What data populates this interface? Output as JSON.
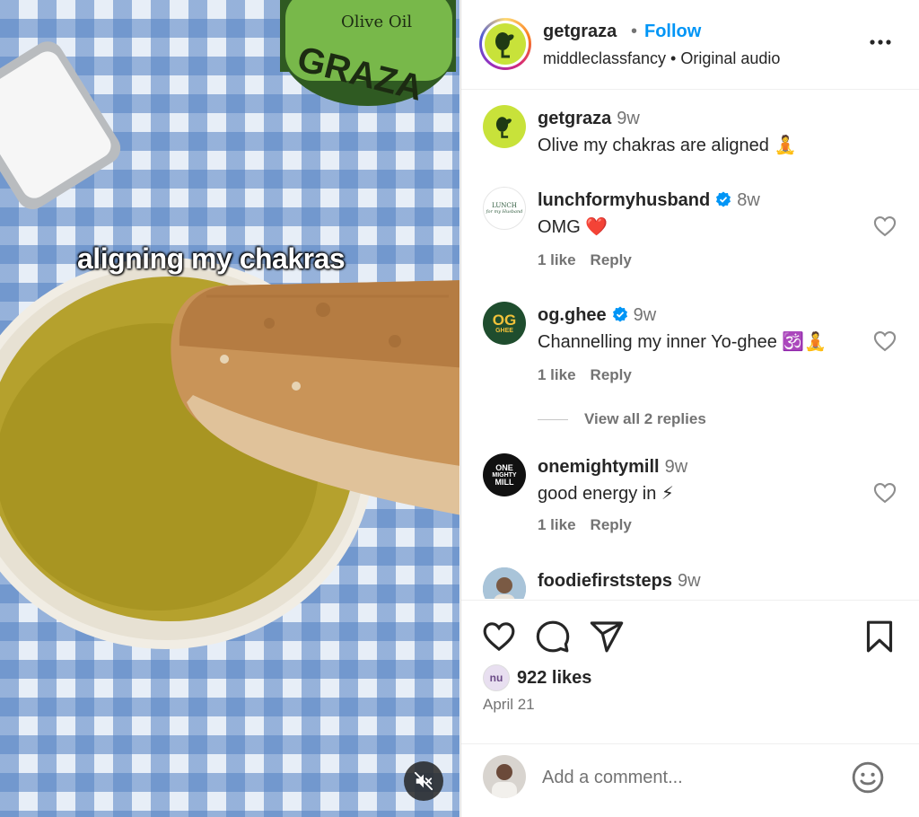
{
  "media": {
    "overlay_text": "aligning my chakras",
    "bottle_label_top": "Olive Oil",
    "bottle_label_brand": "GRAZA"
  },
  "header": {
    "username": "getgraza",
    "separator": "•",
    "follow_label": "Follow",
    "audio": "middleclassfancy • Original audio"
  },
  "comments": [
    {
      "username": "getgraza",
      "time": "9w",
      "text": "Olive my chakras are aligned 🧘",
      "verified": false
    },
    {
      "username": "lunchformyhusband",
      "time": "8w",
      "text": "OMG ❤️",
      "verified": true,
      "likes": "1 like",
      "reply": "Reply"
    },
    {
      "username": "og.ghee",
      "time": "9w",
      "text": "Channelling my inner Yo-ghee 🕉️🧘",
      "verified": true,
      "likes": "1 like",
      "reply": "Reply"
    },
    {
      "username": "onemightymill",
      "time": "9w",
      "text": "good energy in ⚡",
      "verified": false,
      "likes": "1 like",
      "reply": "Reply"
    },
    {
      "username": "foodiefirststeps",
      "time": "9w",
      "text": "",
      "verified": false
    }
  ],
  "view_replies": "View all 2 replies",
  "avatars": {
    "og_ghee_line1": "OG",
    "og_ghee_line2": "GHEE",
    "mill_line1": "ONE",
    "mill_line2": "MIGHTY",
    "mill_line3": "MILL",
    "lunch_line1": "LUNCH",
    "lunch_line2": "for my Husband",
    "liker": "nu"
  },
  "footer": {
    "likes": "922 likes",
    "date": "April 21",
    "comment_placeholder": "Add a comment..."
  },
  "icons": {
    "like": "heart-icon",
    "comment": "comment-icon",
    "share": "send-icon",
    "save": "bookmark-icon",
    "emoji": "smiley-icon",
    "more": "more-dots-icon",
    "mute": "muted-speaker-icon"
  },
  "colors": {
    "follow_blue": "#0095f6",
    "verified_blue": "#0095f6",
    "graza_green": "#c8e23a",
    "muted_text": "#737373"
  }
}
